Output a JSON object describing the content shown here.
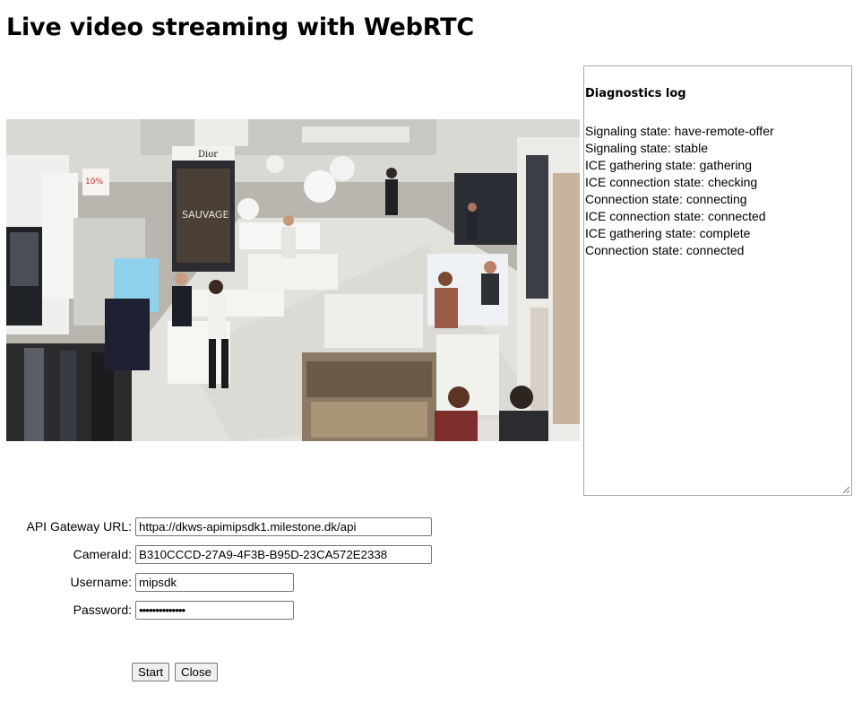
{
  "page": {
    "title": "Live video streaming with WebRTC"
  },
  "diagnostics": {
    "title": "Diagnostics log",
    "lines": [
      "Signaling state: have-remote-offer",
      "Signaling state: stable",
      "ICE gathering state: gathering",
      "ICE connection state: checking",
      "Connection state: connecting",
      "ICE connection state: connected",
      "ICE gathering state: complete",
      "Connection state: connected"
    ]
  },
  "video": {
    "store_sign_1": "Dior",
    "store_sign_2": "10%",
    "poster_text": "SAUVAGE"
  },
  "form": {
    "api_gateway_label": "API Gateway URL:",
    "api_gateway_value": "httpa://dkws-apimipsdk1.milestone.dk/api",
    "camera_id_label": "CameraId:",
    "camera_id_value": "B310CCCD-27A9-4F3B-B95D-23CA572E2338",
    "username_label": "Username:",
    "username_value": "mipsdk",
    "password_label": "Password:",
    "password_value": "••••••••••••••"
  },
  "buttons": {
    "start": "Start",
    "close": "Close"
  }
}
